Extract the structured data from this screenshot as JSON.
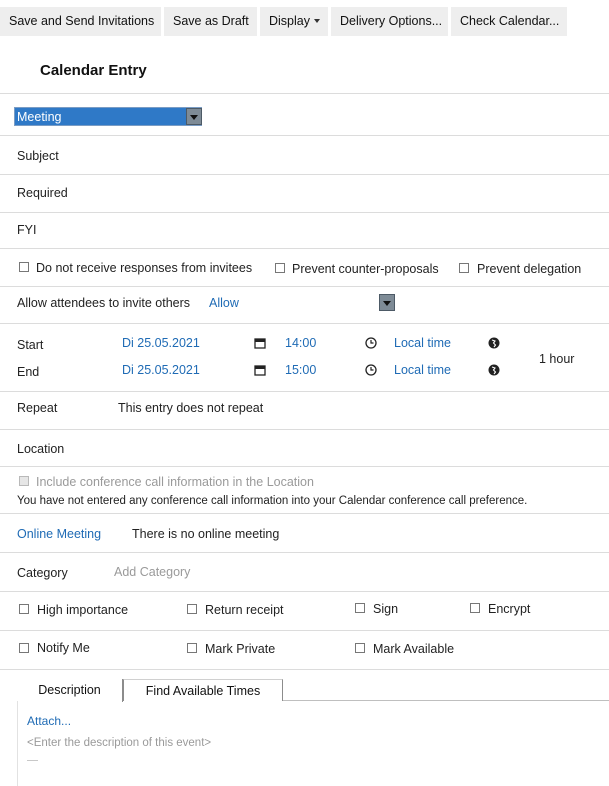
{
  "toolbar": {
    "save_send": "Save and Send Invitations",
    "save_draft": "Save as Draft",
    "display": "Display",
    "delivery_options": "Delivery Options...",
    "check_calendar": "Check Calendar..."
  },
  "form": {
    "title": "Calendar Entry",
    "entry_type": "Meeting",
    "subject_label": "Subject",
    "required_label": "Required",
    "fyi_label": "FYI",
    "options_row1": {
      "no_responses": "Do not receive responses from invitees",
      "prevent_counter": "Prevent counter-proposals",
      "prevent_delegation": "Prevent delegation"
    },
    "allow_invite_label": "Allow attendees to invite others",
    "allow_invite_value": "Allow",
    "start_label": "Start",
    "end_label": "End",
    "start_date": "Di 25.05.2021",
    "start_time": "14:00",
    "end_date": "Di 25.05.2021",
    "end_time": "15:00",
    "timezone_start": "Local time",
    "timezone_end": "Local time",
    "duration": "1 hour",
    "repeat_label": "Repeat",
    "repeat_value": "This entry does not repeat",
    "location_label": "Location",
    "conference_checkbox": "Include conference call information in the Location",
    "conference_note": "You have not entered any conference call information into your Calendar conference call preference.",
    "online_meeting_label": "Online Meeting",
    "online_meeting_value": "There is no online meeting",
    "category_label": "Category",
    "category_placeholder": "Add Category",
    "options_row2": {
      "high_importance": "High importance",
      "return_receipt": "Return receipt",
      "sign": "Sign",
      "encrypt": "Encrypt"
    },
    "options_row3": {
      "notify_me": "Notify Me",
      "mark_private": "Mark Private",
      "mark_available": "Mark Available"
    }
  },
  "tabs": {
    "description": "Description",
    "find_times": "Find Available Times"
  },
  "description": {
    "attach": "Attach...",
    "placeholder": "<Enter the description of this event>"
  },
  "colors": {
    "accent_link": "#1f6bb5",
    "select_highlight": "#2f79c7"
  }
}
